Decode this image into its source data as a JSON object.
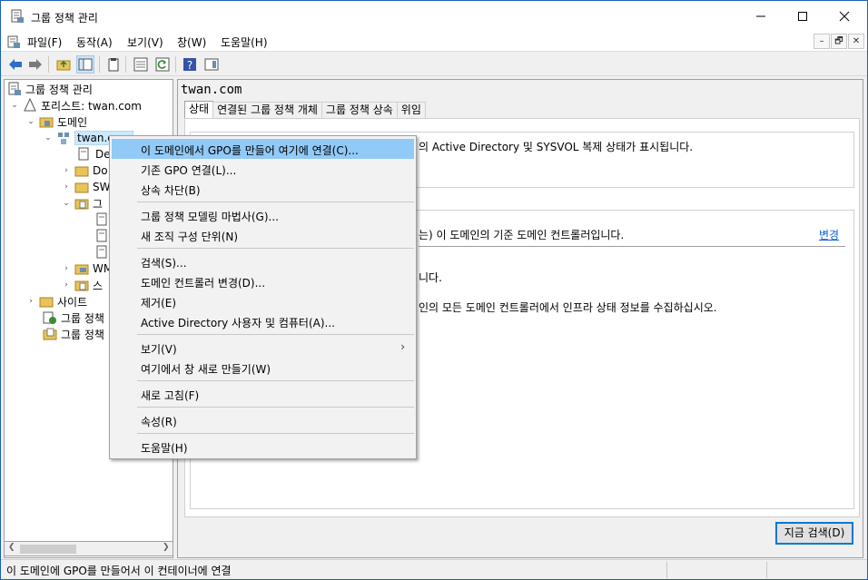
{
  "window": {
    "title": "그룹 정책 관리"
  },
  "menubar": {
    "items": [
      "파일(F)",
      "동작(A)",
      "보기(V)",
      "창(W)",
      "도움말(H)"
    ],
    "mdi": [
      "–",
      "🗗",
      "✕"
    ]
  },
  "tree": {
    "root": "그룹 정책 관리",
    "forest": "포리스트: twan.com",
    "domains": "도메인",
    "domain": "twan.com",
    "children": [
      "De",
      "Do",
      "SW",
      "그",
      "",
      "",
      "",
      "WM",
      "스"
    ],
    "sites": "사이트",
    "modeling": "그룹 정책",
    "results": "그룹 정책"
  },
  "right": {
    "title": "twan.com",
    "tabs": [
      "상태",
      "연결된 그룹 정책 개체",
      "그룹 정책 상속",
      "위임"
    ],
    "line1": "의 Active Directory 및 SYSVOL 복제 상태가 표시됩니다.",
    "line2": "는) 이 도메인의 기준 도메인 컨트롤러입니다.",
    "change_link": "변경",
    "line3": "니다.",
    "line4": "인의 모든 도메인 컨트롤러에서 인프라 상태 정보를 수집하십시오.",
    "search_button": "지금 검색(D)"
  },
  "context_menu": {
    "items": [
      "이 도메인에서 GPO를 만들어 여기에 연결(C)...",
      "기존 GPO 연결(L)...",
      "상속 차단(B)",
      "그룹 정책 모델링 마법사(G)...",
      "새 조직 구성 단위(N)",
      "검색(S)...",
      "도메인 컨트롤러 변경(D)...",
      "제거(E)",
      "Active Directory 사용자 및 컴퓨터(A)...",
      "보기(V)",
      "여기에서 창 새로 만들기(W)",
      "새로 고침(F)",
      "속성(R)",
      "도움말(H)"
    ],
    "submenu_arrow": "›"
  },
  "status": {
    "text": "이 도메인에 GPO를 만들어서 이 컨테이너에 연결"
  },
  "colors": {
    "highlight": "#91c9f7",
    "link": "#0b5ed7",
    "accent": "#0078d7"
  }
}
